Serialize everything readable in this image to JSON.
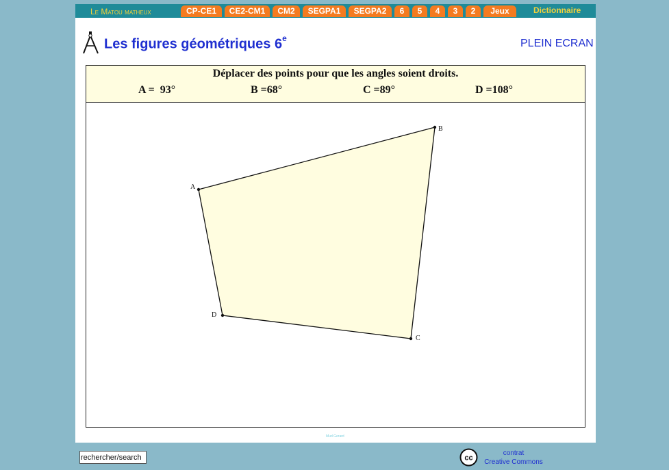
{
  "nav": {
    "brand": "Le Matou matheux",
    "tabs": [
      "CP-CE1",
      "CE2-CM1",
      "CM2",
      "SEGPA1",
      "SEGPA2",
      "6",
      "5",
      "4",
      "3",
      "2",
      "Jeux"
    ],
    "dictionary": "Dictionnaire"
  },
  "header": {
    "title": "Les figures géométriques 6",
    "title_sup": "e",
    "fullscreen": "PLEIN ECRAN"
  },
  "exercise": {
    "instruction": "Déplacer des points pour que les angles soient droits.",
    "angles": [
      {
        "label": "A =",
        "value": "93°"
      },
      {
        "label": "B =",
        "value": "68°"
      },
      {
        "label": "C =",
        "value": "89°"
      },
      {
        "label": "D =",
        "value": "108°"
      }
    ],
    "points": [
      "A",
      "B",
      "C",
      "D"
    ]
  },
  "footer": {
    "watermark": "Mud Gerard",
    "search_value": "rechercher/search",
    "cc_line1": "contrat",
    "cc_line2": "Creative Commons",
    "cc_icon_text": "cc"
  },
  "colors": {
    "nav_bg": "#1f8b99",
    "tab_bg": "#f47b20",
    "brand_text": "#f4d23b",
    "title_text": "#1f2fd0",
    "page_bg": "#8ab9c9",
    "figure_fill": "#fffde0"
  }
}
